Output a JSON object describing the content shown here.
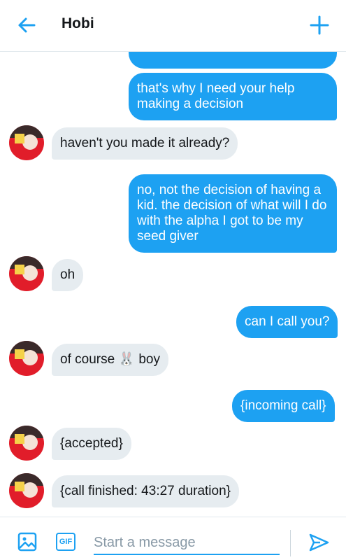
{
  "header": {
    "title": "Hobi"
  },
  "messages": [
    {
      "dir": "out",
      "text": ""
    },
    {
      "dir": "out",
      "text": "that's why I need your help making a decision"
    },
    {
      "dir": "in",
      "text": "haven't you made it already?"
    },
    {
      "dir": "out",
      "text": "no, not the decision of having a kid. the decision of what will I do with the alpha I got to be my seed giver"
    },
    {
      "dir": "in",
      "text": "oh"
    },
    {
      "dir": "out",
      "text": "can I call you?"
    },
    {
      "dir": "in",
      "text": "of course 🐰 boy"
    },
    {
      "dir": "out",
      "text": "{incoming call}"
    },
    {
      "dir": "in",
      "text": "{accepted}"
    },
    {
      "dir": "in",
      "text": "{call finished: 43:27 duration}"
    }
  ],
  "composer": {
    "placeholder": "Start a message",
    "gif_label": "GIF"
  },
  "colors": {
    "accent": "#1da1f2",
    "incoming_bubble": "#e6ecf0"
  },
  "icons": {
    "back": "arrow-left-icon",
    "new": "plus-icon",
    "image": "image-icon",
    "send": "send-icon"
  }
}
